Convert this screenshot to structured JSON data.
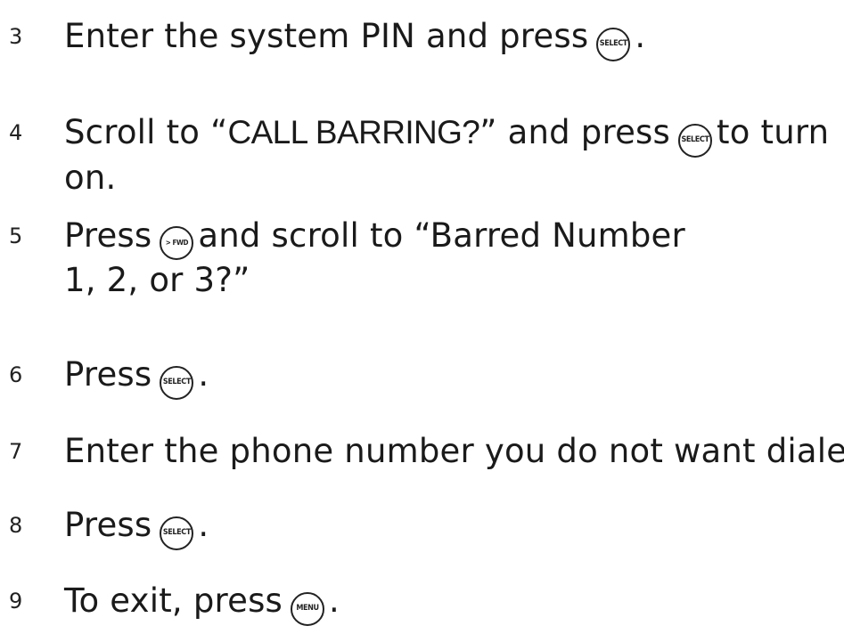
{
  "keys": {
    "select": "SELECT",
    "fwd": "> FWD",
    "menu": "MENU"
  },
  "steps": [
    {
      "num": "3",
      "pre": "Enter the system PIN and press",
      "post": "."
    },
    {
      "num": "4",
      "pre": "Scroll to “",
      "caps": "CALL BARRING?",
      "mid": "” and press",
      "post": "to turn",
      "line2": "on."
    },
    {
      "num": "5",
      "pre": "Press",
      "post": "and scroll to “Barred Number",
      "line2": "1, 2, or 3?”"
    },
    {
      "num": "6",
      "pre": "Press",
      "post": "."
    },
    {
      "num": "7",
      "text": "Enter the phone number you do not want dialed."
    },
    {
      "num": "8",
      "pre": "Press",
      "post": "."
    },
    {
      "num": "9",
      "pre": "To exit, press",
      "post": "."
    }
  ]
}
